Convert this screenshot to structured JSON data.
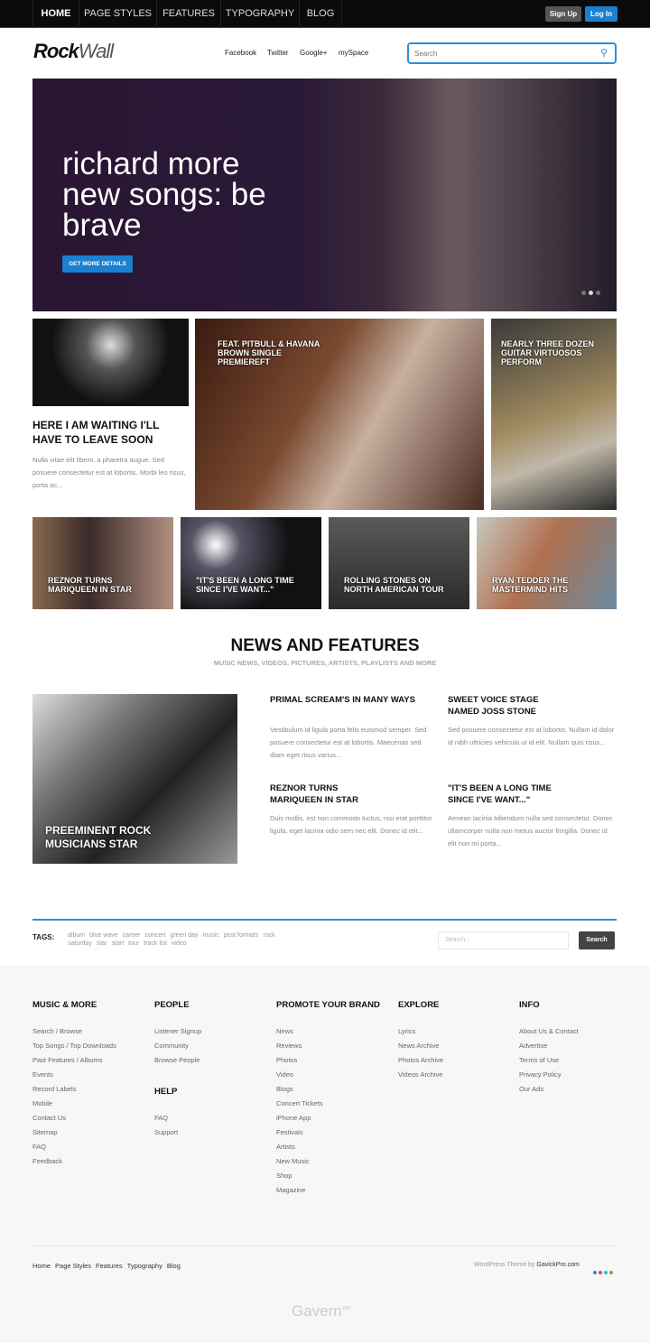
{
  "topnav": {
    "items": [
      "HOME",
      "PAGE STYLES",
      "FEATURES",
      "TYPOGRAPHY",
      "BLOG"
    ],
    "signup": "Sign Up",
    "login": "Log In"
  },
  "header": {
    "logo_bold": "Rock",
    "logo_light": "Wall",
    "social": [
      "Facebook",
      "Twitter",
      "Google+",
      "mySpace"
    ],
    "search_placeholder": "Search"
  },
  "hero": {
    "title": "richard more new songs: be brave",
    "button": "GET MORE DETAILS",
    "slides": 3,
    "active_slide": 2
  },
  "featured": {
    "left": {
      "title": "HERE I AM WAITING I'LL HAVE TO LEAVE SOON",
      "text": "Nulla vitae elit libero, a pharetra augue. Sed posuere consectetur est at lobortis. Morbi leo risus, porta ac..."
    },
    "middle": {
      "caption": "FEAT. PITBULL & HAVANA BROWN SINGLE PREMIEREFT"
    },
    "right": {
      "caption": "NEARLY THREE DOZEN GUITAR VIRTUOSOS PERFORM"
    },
    "tiles": [
      "REZNOR TURNS MARIQUEEN IN STAR",
      "\"IT'S BEEN A LONG TIME SINCE I'VE WANT...\"",
      "ROLLING STONES ON NORTH AMERICAN TOUR",
      "RYAN TEDDER THE MASTERMIND HITS"
    ]
  },
  "news": {
    "title": "NEWS AND FEATURES",
    "subtitle": "MUSIC NEWS, VIDEOS, PICTURES, ARTISTS, PLAYLISTS AND MORE",
    "main_caption": "PREEMINENT ROCK MUSICIANS STAR",
    "articles": [
      {
        "title": "PRIMAL SCREAM'S IN MANY WAYS",
        "text": "Vestibulum id ligula porta felis euismod semper. Sed posuere consectetur est at lobortis. Maecenas sed diam eget risus varius..."
      },
      {
        "title": "SWEET VOICE STAGE NAMED JOSS STONE",
        "text": "Sed posuere consectetur est at lobortis. Nullam id dolor id nibh ultricies vehicula ut id elit. Nullam quis risus..."
      },
      {
        "title": "REZNOR TURNS MARIQUEEN IN STAR",
        "text": "Duis mollis, est non commodo luctus, nisi erat porttitor ligula, eget lacinia odio sem nec elit. Donec id elit..."
      },
      {
        "title": "\"IT'S BEEN A LONG TIME SINCE I'VE WANT...\"",
        "text": "Aenean lacinia bibendum nulla sed consectetur. Donec ullamcorper nulla non metus auctor fringilla. Donec id elit non mi porta..."
      }
    ]
  },
  "tags": {
    "label": "TAGS:",
    "items": [
      "album",
      "blue wave",
      "career",
      "concert",
      "green day",
      "music",
      "post formats",
      "rock",
      "saturday",
      "star",
      "start",
      "tour",
      "track list",
      "video"
    ],
    "search_placeholder": "Search...",
    "search_button": "Search"
  },
  "footer": {
    "columns": [
      {
        "title": "MUSIC & MORE",
        "links": [
          "Search / Browse",
          "Top Songs / Top Downloads",
          "Past Features / Albums",
          "Events",
          "Record Labels",
          "Mobile",
          "Contact Us",
          "Sitemap",
          "FAQ",
          "Feedback"
        ]
      },
      {
        "title": "PEOPLE",
        "links": [
          "Listener Signup",
          "Community",
          "Browse People"
        ]
      },
      {
        "title": "PROMOTE YOUR BRAND",
        "links": [
          "News",
          "Reviews",
          "Photos",
          "Video",
          "Blogs",
          "Concert Tickets",
          "iPhone App",
          "Festivals",
          "Artists",
          "New Music",
          "Shop",
          "Magazine"
        ]
      },
      {
        "title": "EXPLORE",
        "links": [
          "Lyrics",
          "News Archive",
          "Photos Archive",
          "Videos Archive"
        ]
      },
      {
        "title": "INFO",
        "links": [
          "About Us & Contact",
          "Advertise",
          "Terms of Use",
          "Privacy Policy",
          "Our Ads"
        ]
      }
    ],
    "help": {
      "title": "HELP",
      "links": [
        "FAQ",
        "Support"
      ]
    },
    "bottom_links": [
      "Home",
      "Page Styles",
      "Features",
      "Typography",
      "Blog"
    ],
    "credit_prefix": "WordPress Theme by",
    "credit_link": "GavickPro.com",
    "style_colors": [
      "#2b8fd8",
      "#e84c3d",
      "#1cc7d0",
      "#6ab04c"
    ],
    "logo": "Gavern",
    "logo_sup": "WP"
  },
  "colors": {
    "accent": "#2b8fd8",
    "topbar": "#0a0a0a"
  }
}
